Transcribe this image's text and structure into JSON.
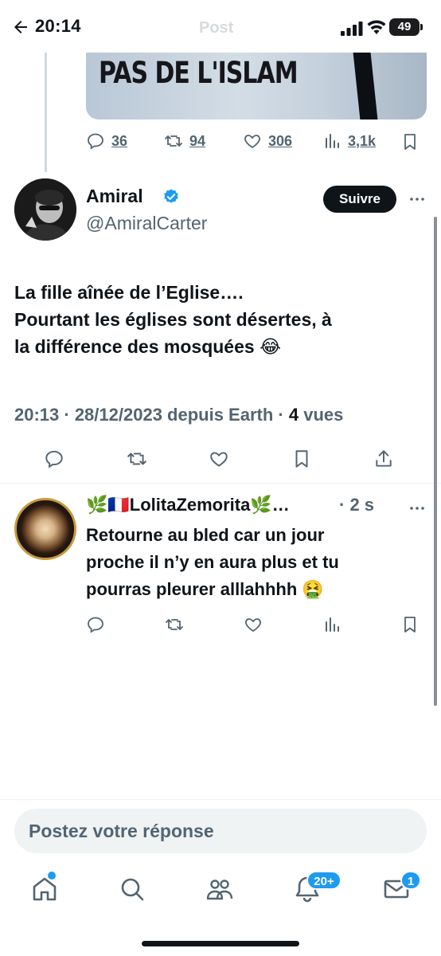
{
  "status_bar": {
    "time": "20:14",
    "battery": "49"
  },
  "header": {
    "title": "Post"
  },
  "quoted_media": {
    "caption_text": "PAS DE L'ISLAM"
  },
  "prev_actions": {
    "replies": "36",
    "reposts": "94",
    "likes": "306",
    "views": "3,1k"
  },
  "main_tweet": {
    "name": "Amiral",
    "handle": "@AmiralCarter",
    "follow_label": "Suivre",
    "text_lines": [
      "La fille aînée de l’Eglise….",
      "Pourtant les églises sont désertes, à",
      "la différence des mosquées 😂"
    ],
    "meta": "20:13 · 28/12/2023 depuis Earth · ",
    "views_count": "4",
    "views_label": " vues"
  },
  "reply": {
    "name": "🌿🇫🇷LolitaZemorita🌿…",
    "time": "· 2 s",
    "text_lines": [
      "Retourne au bled car un jour",
      "proche il n’y en aura plus et tu",
      "pourras pleurer alllahhhh 🤮"
    ]
  },
  "composer": {
    "placeholder": "Postez votre réponse"
  },
  "tab_bar": {
    "notifications_badge": "20+",
    "messages_badge": "1"
  },
  "colors": {
    "accent": "#1d9bf0",
    "text": "#0f1419",
    "secondary": "#536471"
  }
}
